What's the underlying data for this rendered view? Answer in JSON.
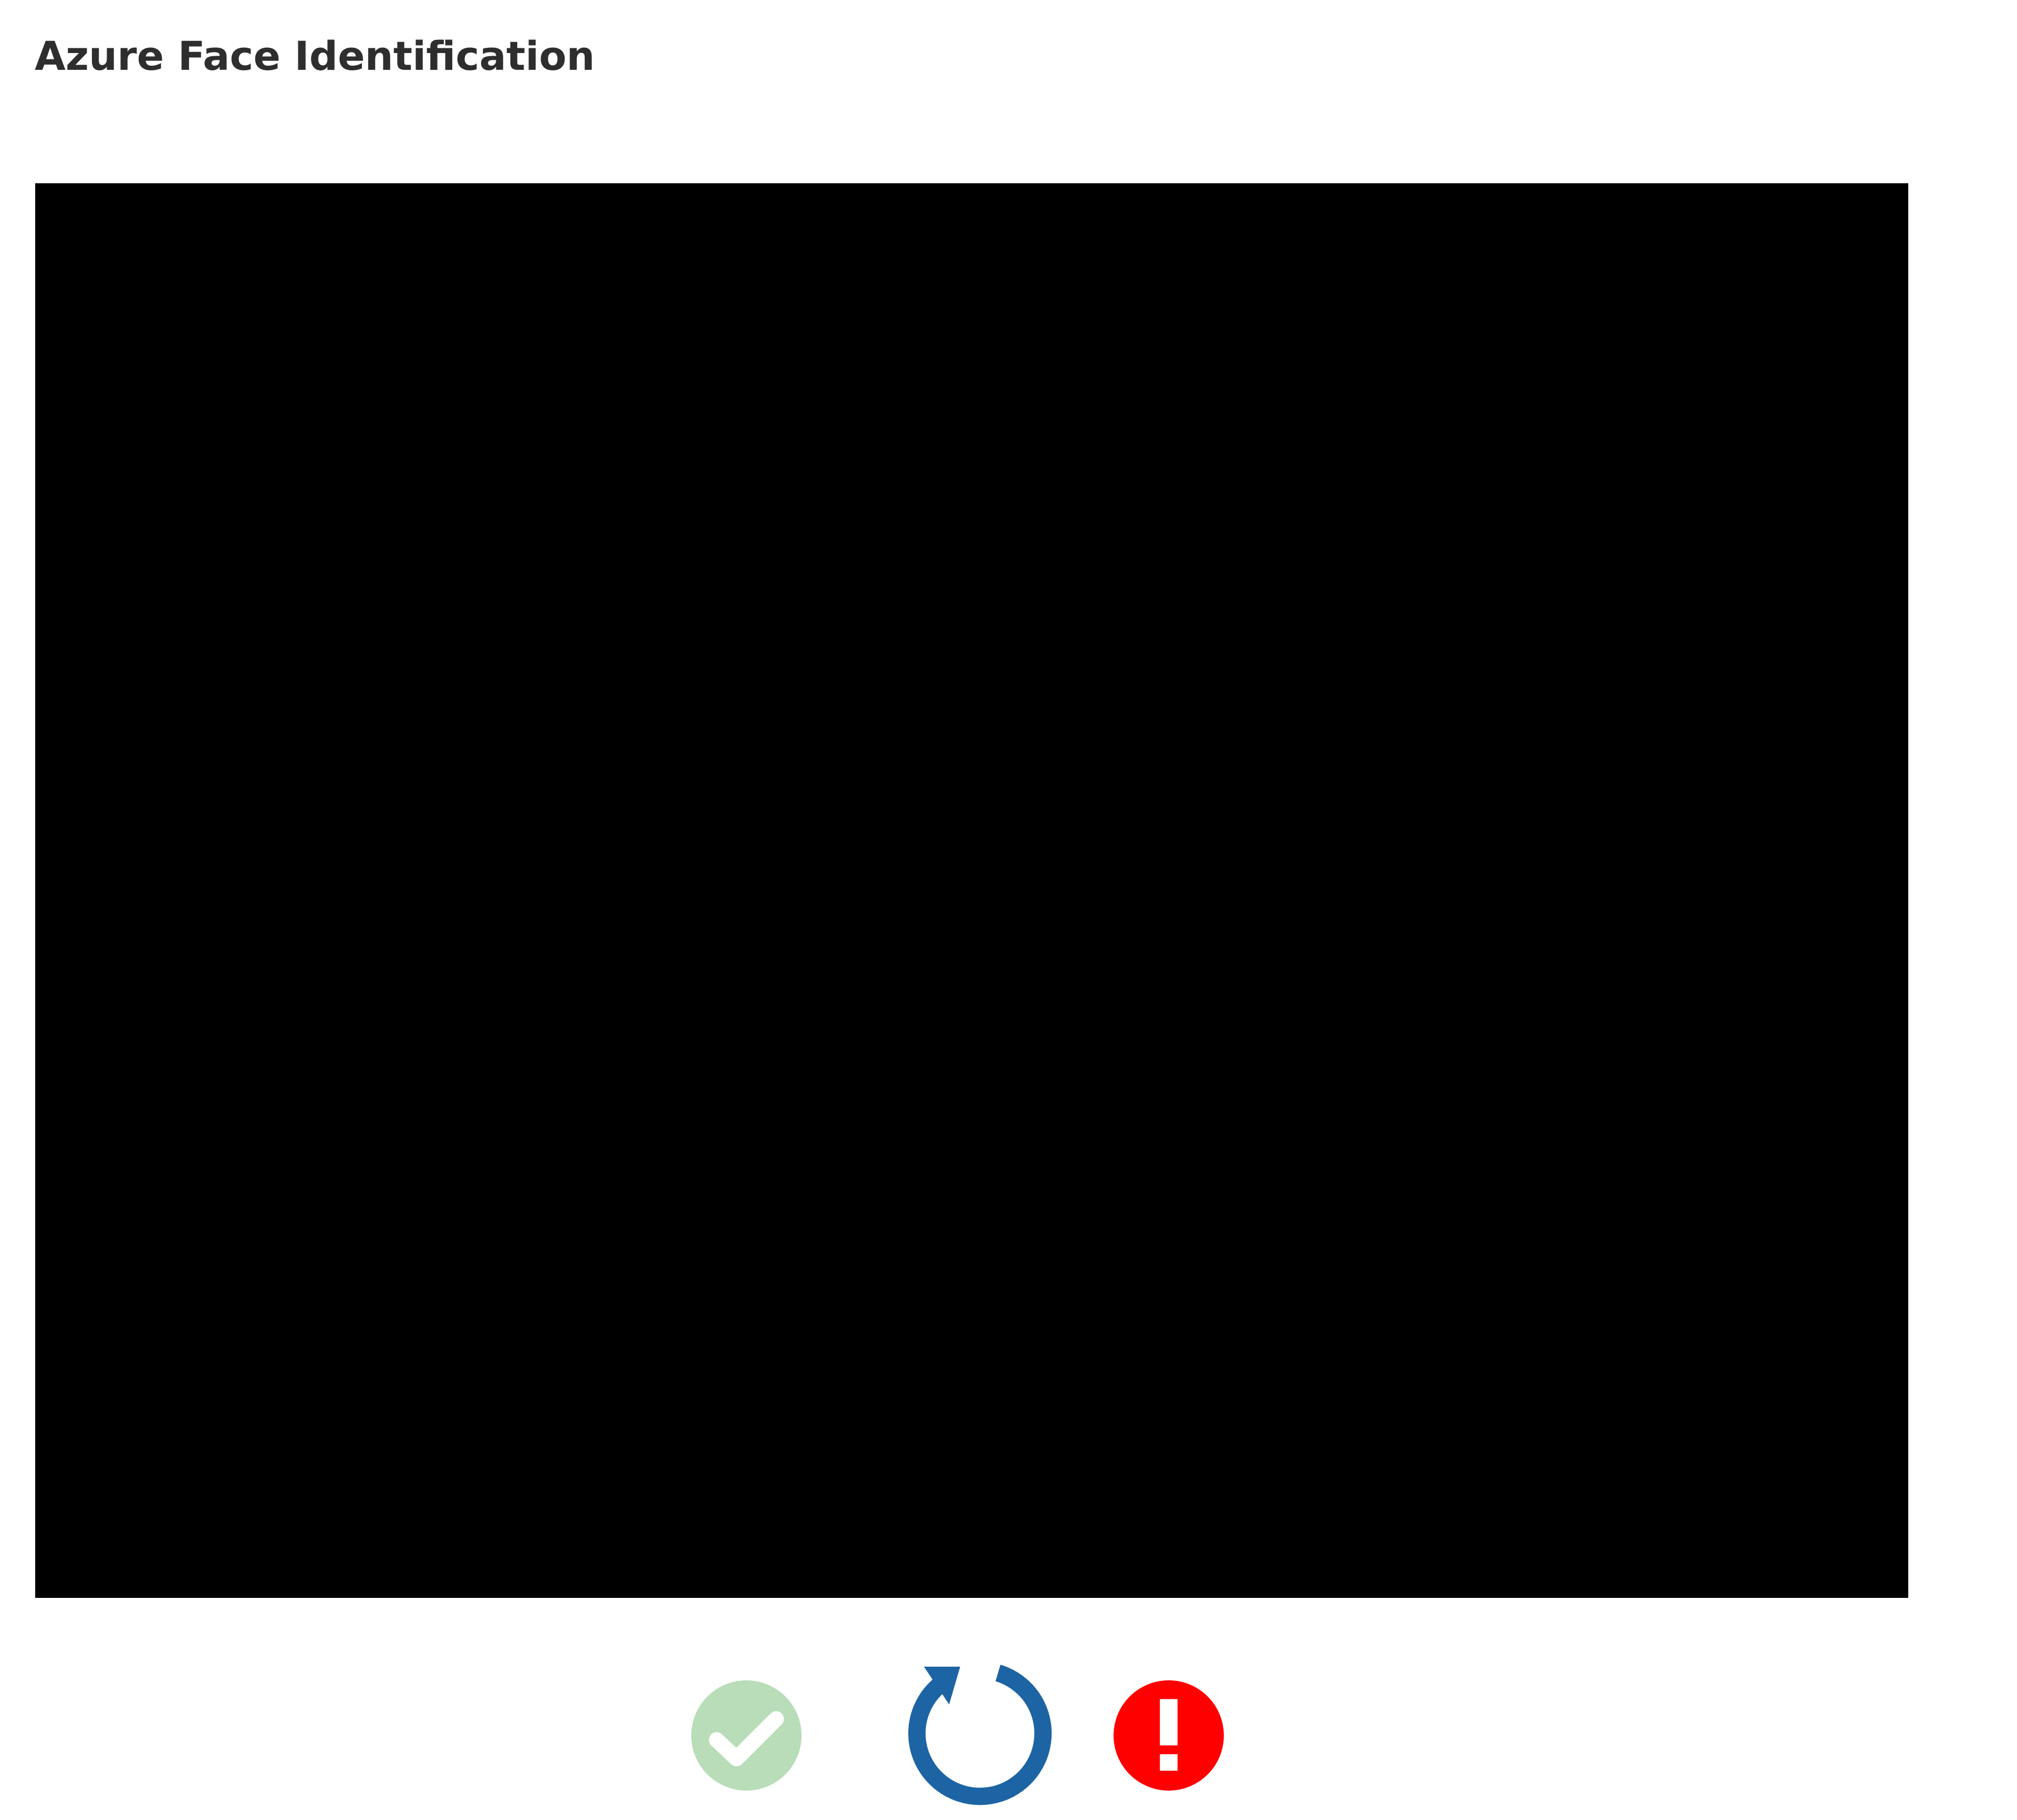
{
  "header": {
    "title": "Azure Face Identification"
  },
  "video": {
    "background_color": "#010001"
  },
  "status_icons": [
    {
      "name": "success",
      "icon": "check-circle-icon",
      "state": "inactive",
      "color": "#b8ddb8"
    },
    {
      "name": "refresh",
      "icon": "refresh-icon",
      "state": "active",
      "color": "#1d64a4"
    },
    {
      "name": "error",
      "icon": "exclamation-circle-icon",
      "state": "active",
      "color": "#ff0000"
    }
  ]
}
